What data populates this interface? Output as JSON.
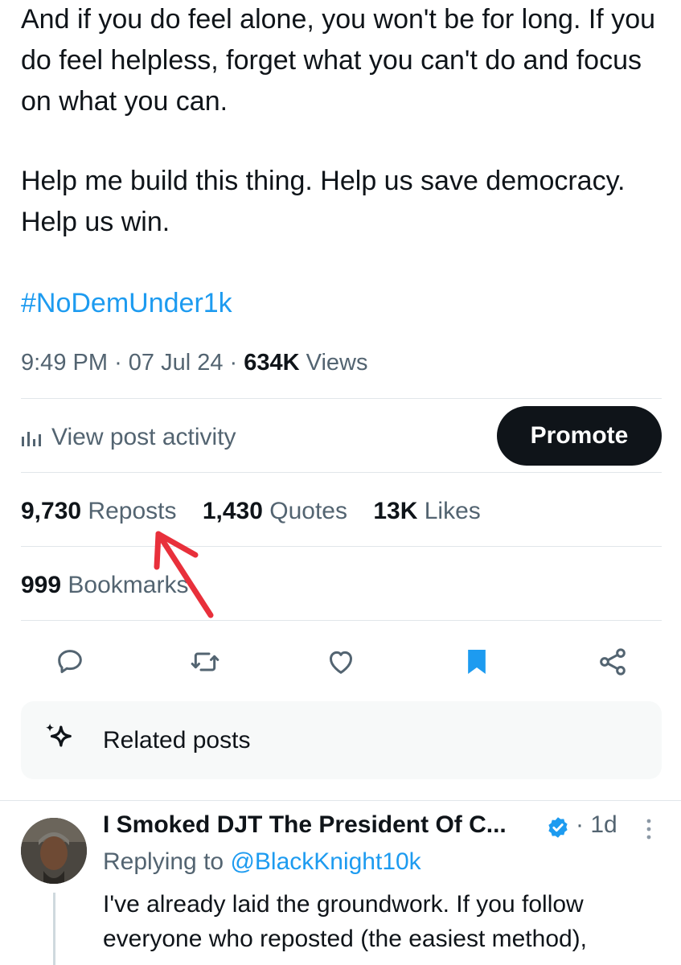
{
  "tweet": {
    "paragraph1": "And if you do feel alone, you won't be for long. If you do feel helpless, forget what you can't do and focus on what you can.",
    "paragraph2": "Help me build this thing. Help us save democracy. Help us win.",
    "hashtag": "#NoDemUnder1k",
    "time": "9:49 PM",
    "date": "07 Jul 24",
    "views_count": "634K",
    "views_label": "Views"
  },
  "activity": {
    "label": "View post activity",
    "promote_label": "Promote"
  },
  "stats": {
    "reposts_count": "9,730",
    "reposts_label": "Reposts",
    "quotes_count": "1,430",
    "quotes_label": "Quotes",
    "likes_count": "13K",
    "likes_label": "Likes",
    "bookmarks_count": "999",
    "bookmarks_label": "Bookmarks"
  },
  "actions": {
    "icons": [
      "reply-icon",
      "repost-icon",
      "like-icon",
      "bookmark-icon",
      "share-icon"
    ],
    "bookmark_color": "#1d9bf0"
  },
  "related": {
    "label": "Related posts"
  },
  "reply": {
    "name": "I Smoked DJT The President Of C...",
    "time": "1d",
    "replying_prefix": "Replying to",
    "replying_handle": "@BlackKnight10k",
    "text": "I've already laid the groundwork. If you follow everyone who reposted (the easiest method),"
  },
  "colors": {
    "accent": "#1d9bf0",
    "text": "#0f1419",
    "muted": "#536471",
    "annotation_arrow": "#e8303b"
  }
}
